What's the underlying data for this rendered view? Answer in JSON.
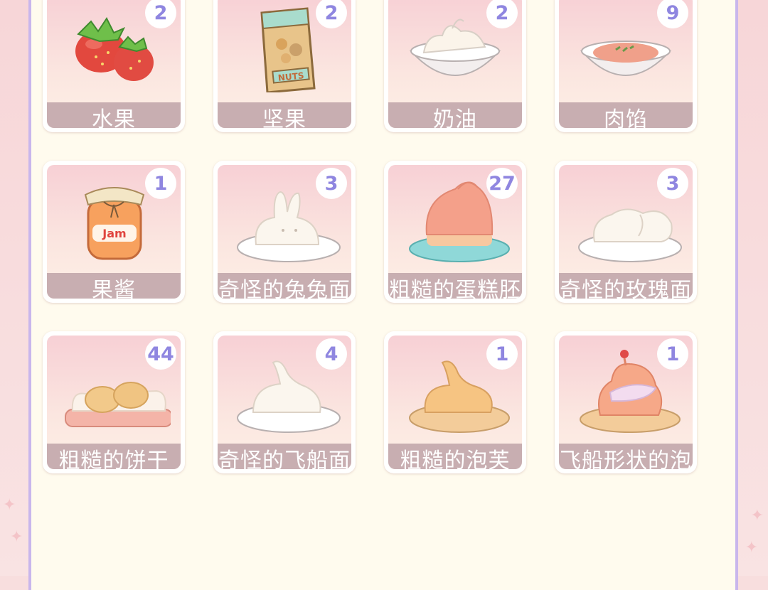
{
  "items": [
    {
      "name": "水果",
      "count": "2",
      "icon": "strawberry-icon"
    },
    {
      "name": "坚果",
      "count": "2",
      "icon": "nuts-bag-icon"
    },
    {
      "name": "奶油",
      "count": "2",
      "icon": "cream-bowl-icon"
    },
    {
      "name": "肉馅",
      "count": "9",
      "icon": "meat-filling-bowl-icon"
    },
    {
      "name": "果酱",
      "count": "1",
      "icon": "jam-jar-icon"
    },
    {
      "name": "奇怪的兔兔面",
      "count": "3",
      "icon": "bunny-dough-icon"
    },
    {
      "name": "粗糙的蛋糕胚",
      "count": "27",
      "icon": "bunny-cake-icon"
    },
    {
      "name": "奇怪的玫瑰面",
      "count": "3",
      "icon": "rose-dough-icon"
    },
    {
      "name": "粗糙的饼干",
      "count": "44",
      "icon": "cookies-tray-icon"
    },
    {
      "name": "奇怪的飞船面",
      "count": "4",
      "icon": "ship-dough-icon"
    },
    {
      "name": "粗糙的泡芙",
      "count": "1",
      "icon": "puff-pastry-icon"
    },
    {
      "name": "飞船形状的泡",
      "count": "1",
      "icon": "ship-puff-icon"
    }
  ],
  "colors": {
    "panel": "#fffbee",
    "border": "#c9b6ec",
    "label_bg": "#c8aeb1",
    "count_text": "#8f86e0"
  }
}
